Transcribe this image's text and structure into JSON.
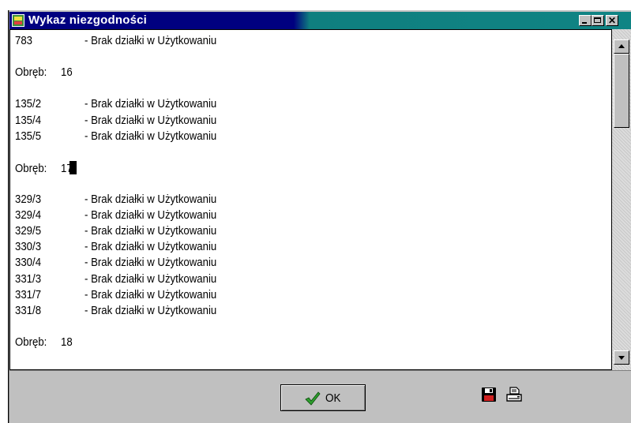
{
  "window": {
    "title": "Wykaz niezgodności",
    "icon": "app-icon",
    "controls": [
      "minimize-icon",
      "maximize-icon",
      "close-icon"
    ],
    "close_glyph": "✕"
  },
  "content": {
    "lines": [
      {
        "kind": "item",
        "code": "783",
        "desc": "- Brak działki w Użytkowaniu"
      },
      {
        "kind": "obreb",
        "label": "Obręb:",
        "value": "16"
      },
      {
        "kind": "item",
        "code": "135/2",
        "desc": "- Brak działki w Użytkowaniu"
      },
      {
        "kind": "item",
        "code": "135/4",
        "desc": "- Brak działki w Użytkowaniu"
      },
      {
        "kind": "item",
        "code": "135/5",
        "desc": "- Brak działki w Użytkowaniu"
      },
      {
        "kind": "obreb",
        "label": "Obręb:",
        "value": "17"
      },
      {
        "kind": "item",
        "code": "329/3",
        "desc": "- Brak działki w Użytkowaniu"
      },
      {
        "kind": "item",
        "code": "329/4",
        "desc": "- Brak działki w Użytkowaniu"
      },
      {
        "kind": "item",
        "code": "329/5",
        "desc": "- Brak działki w Użytkowaniu"
      },
      {
        "kind": "item",
        "code": "330/3",
        "desc": "- Brak działki w Użytkowaniu"
      },
      {
        "kind": "item",
        "code": "330/4",
        "desc": "- Brak działki w Użytkowaniu"
      },
      {
        "kind": "item",
        "code": "331/3",
        "desc": "- Brak działki w Użytkowaniu"
      },
      {
        "kind": "item",
        "code": "331/7",
        "desc": "- Brak działki w Użytkowaniu"
      },
      {
        "kind": "item",
        "code": "331/8",
        "desc": "- Brak działki w Użytkowaniu"
      },
      {
        "kind": "obreb",
        "label": "Obręb:",
        "value": "18"
      }
    ]
  },
  "footer": {
    "ok_label": "OK",
    "ok_icon": "checkmark-icon",
    "save_icon": "floppy-disk-icon",
    "print_icon": "printer-icon"
  },
  "colors": {
    "title_bar_start": "#000080",
    "title_bar_end": "#108484",
    "checkmark": "#2e9e2e"
  }
}
